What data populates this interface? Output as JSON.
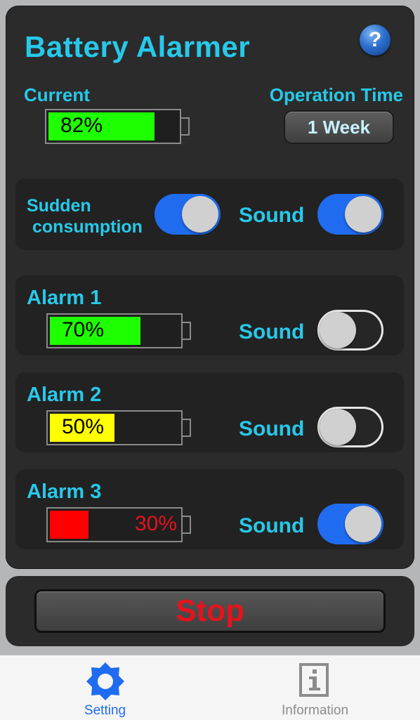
{
  "app": {
    "title": "Battery Alarmer",
    "help_glyph": "?"
  },
  "current": {
    "label": "Current",
    "percent_text": "82%",
    "level": 0.82,
    "fill_color": "#1eff00"
  },
  "operation_time": {
    "label": "Operation Time",
    "value": "1 Week"
  },
  "sudden": {
    "label_line1": "Sudden",
    "label_line2": "consumption",
    "enabled": true,
    "sound_label": "Sound",
    "sound_enabled": true
  },
  "alarms": [
    {
      "label": "Alarm 1",
      "percent_text": "70%",
      "level": 0.7,
      "fill_color": "#1eff00",
      "text_color": "#000000",
      "sound_label": "Sound",
      "sound_enabled": false
    },
    {
      "label": "Alarm 2",
      "percent_text": "50%",
      "level": 0.5,
      "fill_color": "#ffff00",
      "text_color": "#000000",
      "sound_label": "Sound",
      "sound_enabled": false
    },
    {
      "label": "Alarm 3",
      "percent_text": "30%",
      "level": 0.3,
      "fill_color": "#ff0000",
      "text_color": "#e5131c",
      "sound_label": "Sound",
      "sound_enabled": true
    }
  ],
  "stop_button": {
    "label": "Stop",
    "color": "#e5131c"
  },
  "tabs": [
    {
      "label": "Setting",
      "icon": "gear-icon",
      "active": true
    },
    {
      "label": "Information",
      "icon": "info-icon",
      "active": false
    }
  ],
  "colors": {
    "accent_cyan": "#27c9ea",
    "toggle_on": "#1f6cf0",
    "panel": "#2b2b2b"
  }
}
